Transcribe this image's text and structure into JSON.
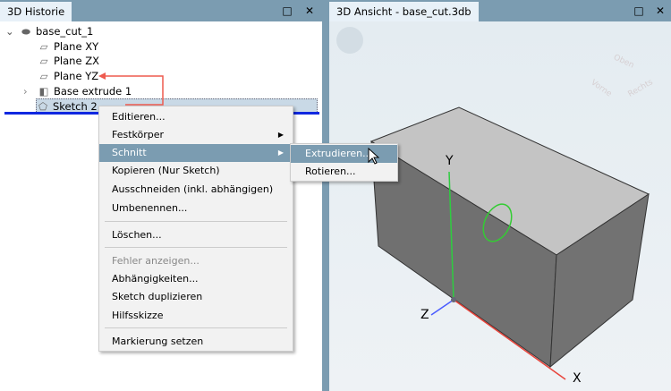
{
  "left_panel": {
    "title": "3D Historie",
    "maximize_icon": "□",
    "close_icon": "✕",
    "tree": [
      {
        "label": "base_cut_1",
        "icon": "part-icon",
        "expander": "⌄"
      },
      {
        "label": "Plane XY",
        "icon": "plane-icon"
      },
      {
        "label": "Plane ZX",
        "icon": "plane-icon"
      },
      {
        "label": "Plane YZ",
        "icon": "plane-icon"
      },
      {
        "label": "Base extrude 1",
        "icon": "extrude-icon",
        "expander": "›"
      },
      {
        "label": "Sketch 2",
        "icon": "sketch-icon",
        "selected": true
      }
    ]
  },
  "right_panel": {
    "title": "3D Ansicht - base_cut.3db",
    "maximize_icon": "□",
    "close_icon": "✕",
    "viewcube": {
      "top": "Oben",
      "front": "Vorne",
      "right": "Rechts"
    },
    "axes": {
      "x": "X",
      "y": "Y",
      "z": "Z"
    }
  },
  "context_menu": {
    "items": [
      {
        "label": "Editieren..."
      },
      {
        "label": "Festkörper",
        "submenu": true
      },
      {
        "label": "Schnitt",
        "submenu": true,
        "highlighted": true
      },
      {
        "label": "Kopieren (Nur Sketch)"
      },
      {
        "label": "Ausschneiden (inkl. abhängigen)"
      },
      {
        "label": "Umbenennen..."
      },
      {
        "label": "Löschen..."
      },
      {
        "label": "Fehler anzeigen...",
        "disabled": true
      },
      {
        "label": "Abhängigkeiten..."
      },
      {
        "label": "Sketch duplizieren"
      },
      {
        "label": "Hilfsskizze"
      },
      {
        "label": "Markierung setzen"
      }
    ]
  },
  "submenu": {
    "items": [
      {
        "label": "Extrudieren...",
        "highlighted": true
      },
      {
        "label": "Rotieren..."
      }
    ]
  },
  "colors": {
    "accent": "#7b9cb1",
    "x_axis": "#e8453c",
    "y_axis": "#2ecc40",
    "z_axis": "#4a5cff"
  }
}
